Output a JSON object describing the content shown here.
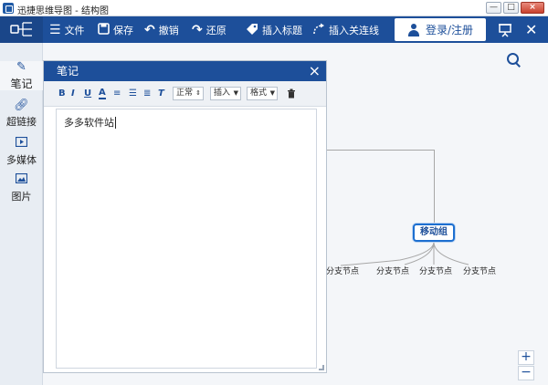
{
  "window": {
    "title": "迅捷思维导图 - 结构图",
    "min_label": "—",
    "max_label": "□",
    "close_label": "×"
  },
  "toolbar": {
    "file_label": "文件",
    "save_label": "保存",
    "undo_label": "撤销",
    "redo_label": "还原",
    "insert_title_label": "插入标题",
    "insert_link_label": "插入关连线",
    "login_label": "登录/注册"
  },
  "sidebar": {
    "items": [
      {
        "label": "笔记"
      },
      {
        "label": "超链接"
      },
      {
        "label": "多媒体"
      },
      {
        "label": "图片"
      }
    ]
  },
  "note": {
    "title": "笔记",
    "close_label": "×",
    "paragraph_style": "正常",
    "insert_label": "插入",
    "format_label": "格式",
    "content": "多多软件站"
  },
  "mindmap": {
    "main_node": "移动组",
    "sub_nodes": [
      "分支节点",
      "分支节点",
      "分支节点",
      "分支节点"
    ]
  },
  "zoom": {
    "in_label": "+",
    "out_label": "−"
  },
  "colors": {
    "accent": "#1d4f9a",
    "node_border": "#1d6fd0"
  }
}
